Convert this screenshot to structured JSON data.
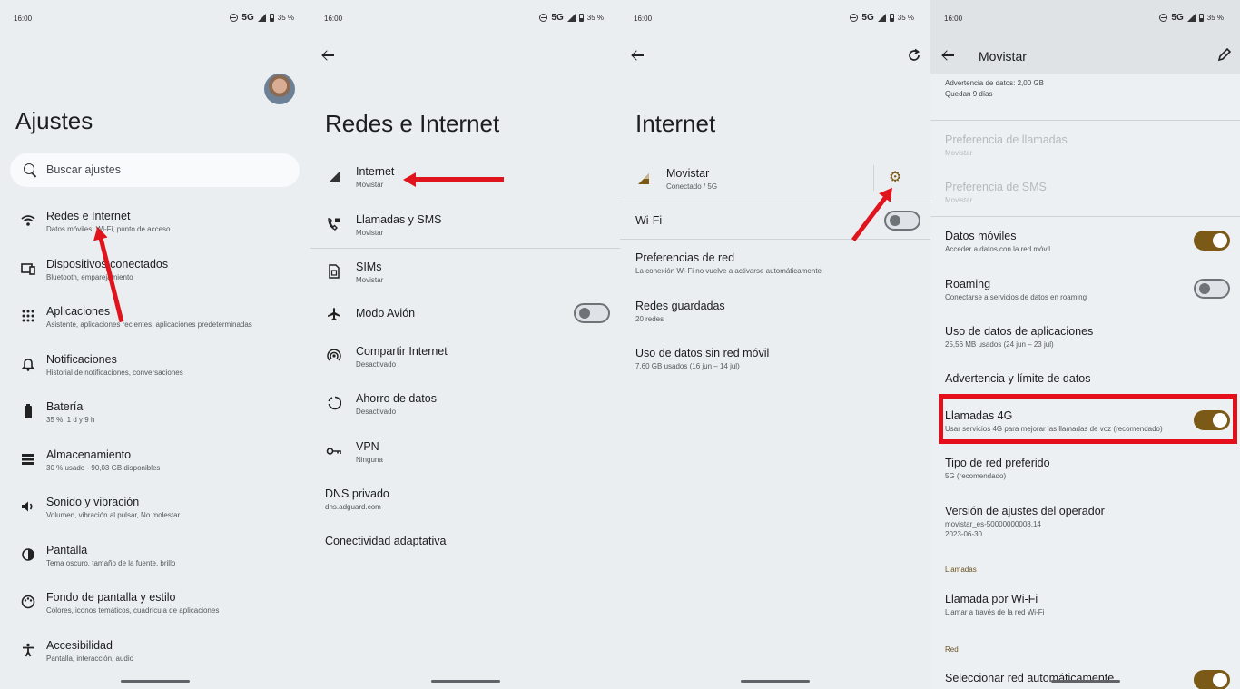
{
  "status": {
    "time": "16:00",
    "network": "5G",
    "battery": "35 %"
  },
  "panel1": {
    "title": "Ajustes",
    "search_placeholder": "Buscar ajustes",
    "items": [
      {
        "title": "Redes e Internet",
        "subtitle": "Datos móviles, Wi-Fi, punto de acceso",
        "icon": "wifi-icon"
      },
      {
        "title": "Dispositivos conectados",
        "subtitle": "Bluetooth, emparejamiento",
        "icon": "devices-icon"
      },
      {
        "title": "Aplicaciones",
        "subtitle": "Asistente, aplicaciones recientes, aplicaciones predeterminadas",
        "icon": "apps-grid-icon"
      },
      {
        "title": "Notificaciones",
        "subtitle": "Historial de notificaciones, conversaciones",
        "icon": "bell-icon"
      },
      {
        "title": "Batería",
        "subtitle": "35 %: 1 d y 9 h",
        "icon": "battery-icon"
      },
      {
        "title": "Almacenamiento",
        "subtitle": "30 % usado - 90,03 GB disponibles",
        "icon": "storage-icon"
      },
      {
        "title": "Sonido y vibración",
        "subtitle": "Volumen, vibración al pulsar, No molestar",
        "icon": "speaker-icon"
      },
      {
        "title": "Pantalla",
        "subtitle": "Tema oscuro, tamaño de la fuente, brillo",
        "icon": "display-icon"
      },
      {
        "title": "Fondo de pantalla y estilo",
        "subtitle": "Colores, iconos temáticos, cuadrícula de aplicaciones",
        "icon": "palette-icon"
      },
      {
        "title": "Accesibilidad",
        "subtitle": "Pantalla, interacción, audio",
        "icon": "accessibility-icon"
      }
    ]
  },
  "panel2": {
    "title": "Redes e Internet",
    "items": [
      {
        "title": "Internet",
        "subtitle": "Movistar",
        "icon": "signal-icon"
      },
      {
        "title": "Llamadas y SMS",
        "subtitle": "Movistar",
        "icon": "call-sms-icon"
      },
      {
        "title": "SIMs",
        "subtitle": "Movistar",
        "icon": "sim-icon"
      },
      {
        "title": "Modo Avión",
        "subtitle": "",
        "icon": "airplane-icon"
      },
      {
        "title": "Compartir Internet",
        "subtitle": "Desactivado",
        "icon": "hotspot-icon"
      },
      {
        "title": "Ahorro de datos",
        "subtitle": "Desactivado",
        "icon": "data-saver-icon"
      },
      {
        "title": "VPN",
        "subtitle": "Ninguna",
        "icon": "vpn-key-icon"
      },
      {
        "title": "DNS privado",
        "subtitle": "dns.adguard.com"
      },
      {
        "title": "Conectividad adaptativa",
        "subtitle": ""
      }
    ]
  },
  "panel3": {
    "title": "Internet",
    "carrier": {
      "title": "Movistar",
      "subtitle": "Conectado / 5G"
    },
    "wifi": "Wi-Fi",
    "items": [
      {
        "title": "Preferencias de red",
        "subtitle": "La conexión Wi-Fi no vuelve a activarse automáticamente"
      },
      {
        "title": "Redes guardadas",
        "subtitle": "20 redes"
      },
      {
        "title": "Uso de datos sin red móvil",
        "subtitle": "7,60 GB usados (16 jun – 14 jul)"
      }
    ]
  },
  "panel4": {
    "title": "Movistar",
    "warning": {
      "line1": "Advertencia de datos: 2,00 GB",
      "line2": "Quedan 9 días"
    },
    "items": [
      {
        "title": "Preferencia de llamadas",
        "subtitle": "Movistar"
      },
      {
        "title": "Preferencia de SMS",
        "subtitle": "Movistar"
      },
      {
        "title": "Datos móviles",
        "subtitle": "Acceder a datos con la red móvil"
      },
      {
        "title": "Roaming",
        "subtitle": "Conectarse a servicios de datos en roaming"
      },
      {
        "title": "Uso de datos de aplicaciones",
        "subtitle": "25,56 MB usados (24 jun – 23 jul)"
      },
      {
        "title": "Advertencia y límite de datos",
        "subtitle": ""
      },
      {
        "title": "Llamadas 4G",
        "subtitle": "Usar servicios 4G para mejorar las llamadas de voz (recomendado)"
      },
      {
        "title": "Tipo de red preferido",
        "subtitle": "5G (recomendado)"
      },
      {
        "title": "Versión de ajustes del operador",
        "subtitle": "movistar_es-50000000008.14",
        "subtitle2": "2023-06-30"
      },
      {
        "title": "Llamada por Wi-Fi",
        "subtitle": "Llamar a través de la red Wi-Fi"
      },
      {
        "title": "Seleccionar red automáticamente",
        "subtitle": ""
      }
    ],
    "section_calls": "Llamadas",
    "section_network": "Red"
  },
  "colors": {
    "accent": "#7a5a16",
    "highlight": "#e40f1a",
    "background": "#eaeef1"
  }
}
